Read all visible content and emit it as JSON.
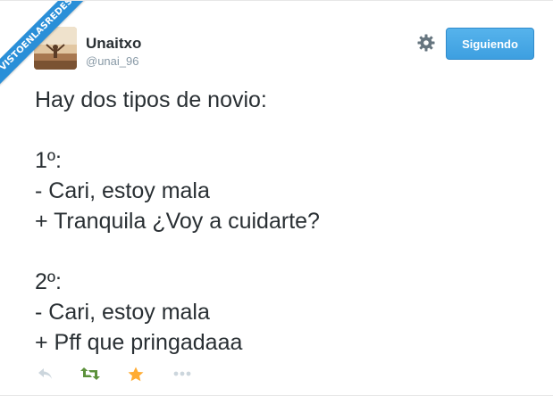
{
  "watermark": {
    "text": "VISTOENLASREDES"
  },
  "user": {
    "display_name": "Unaitxo",
    "handle": "@unai_96"
  },
  "header": {
    "settings_icon": "gear-icon",
    "follow_label": "Siguiendo"
  },
  "tweet": {
    "text": "Hay dos tipos de novio:\n\n1º:\n- Cari, estoy mala\n+ Tranquila ¿Voy a cuidarte?\n\n2º:\n- Cari, estoy mala\n+ Pff que pringadaaa"
  },
  "actions": [
    {
      "icon": "reply-icon"
    },
    {
      "icon": "retweet-icon"
    },
    {
      "icon": "favorite-star-icon"
    },
    {
      "icon": "more-dots-icon"
    }
  ],
  "colors": {
    "accent": "#3d9fe0",
    "retweet": "#5c913b",
    "favorite": "#ffac33",
    "muted": "#ccd6dd",
    "text": "#292f33",
    "watermark": "#2a8fd8"
  }
}
